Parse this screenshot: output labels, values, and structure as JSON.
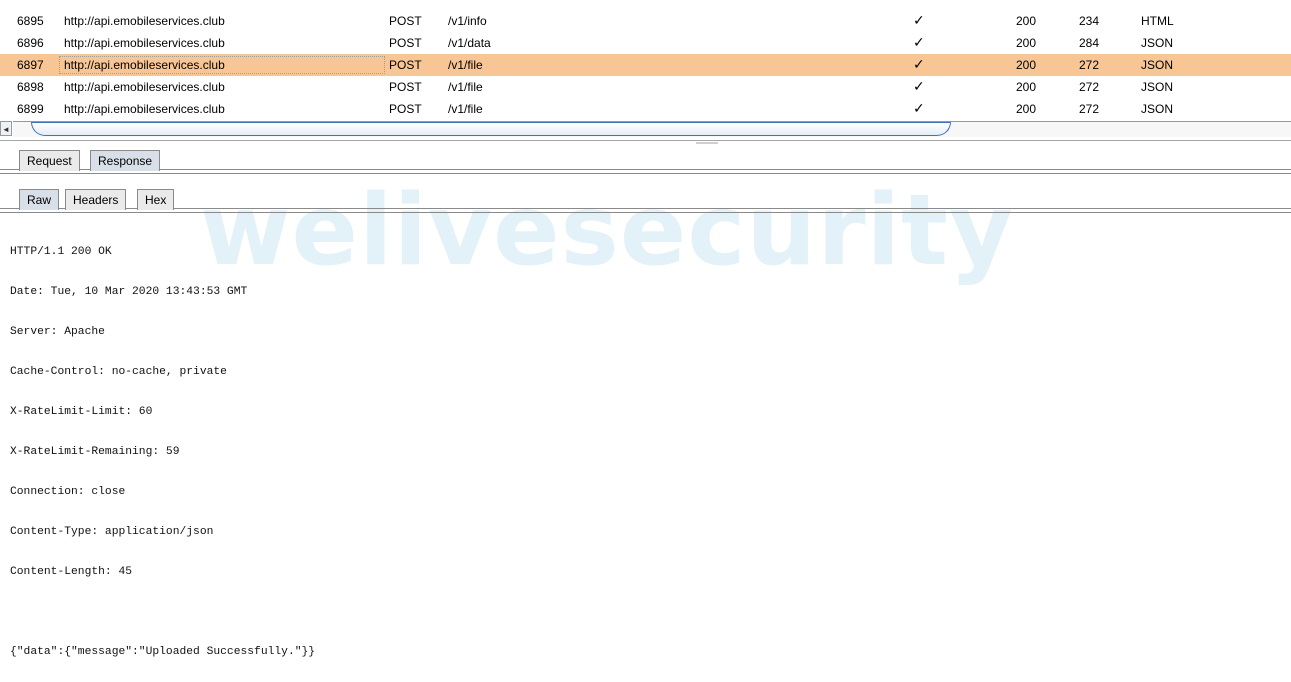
{
  "watermark": "welivesecurity",
  "table": {
    "rows": [
      {
        "id": "6895",
        "host": "http://api.emobileservices.club",
        "method": "POST",
        "url": "/v1/info",
        "check": "✓",
        "status": "200",
        "length": "234",
        "mime": "HTML"
      },
      {
        "id": "6896",
        "host": "http://api.emobileservices.club",
        "method": "POST",
        "url": "/v1/data",
        "check": "✓",
        "status": "200",
        "length": "284",
        "mime": "JSON"
      },
      {
        "id": "6897",
        "host": "http://api.emobileservices.club",
        "method": "POST",
        "url": "/v1/file",
        "check": "✓",
        "status": "200",
        "length": "272",
        "mime": "JSON"
      },
      {
        "id": "6898",
        "host": "http://api.emobileservices.club",
        "method": "POST",
        "url": "/v1/file",
        "check": "✓",
        "status": "200",
        "length": "272",
        "mime": "JSON"
      },
      {
        "id": "6899",
        "host": "http://api.emobileservices.club",
        "method": "POST",
        "url": "/v1/file",
        "check": "✓",
        "status": "200",
        "length": "272",
        "mime": "JSON"
      }
    ],
    "selected_index": 2
  },
  "scroll_left_arrow": "◄",
  "tabs": {
    "request_label": "Request",
    "response_label": "Response"
  },
  "subtabs": {
    "raw_label": "Raw",
    "headers_label": "Headers",
    "hex_label": "Hex"
  },
  "response": {
    "lines": [
      "HTTP/1.1 200 OK",
      "Date: Tue, 10 Mar 2020 13:43:53 GMT",
      "Server: Apache",
      "Cache-Control: no-cache, private",
      "X-RateLimit-Limit: 60",
      "X-RateLimit-Remaining: 59",
      "Connection: close",
      "Content-Type: application/json",
      "Content-Length: 45",
      "",
      "{\"data\":{\"message\":\"Uploaded Successfully.\"}}"
    ]
  }
}
